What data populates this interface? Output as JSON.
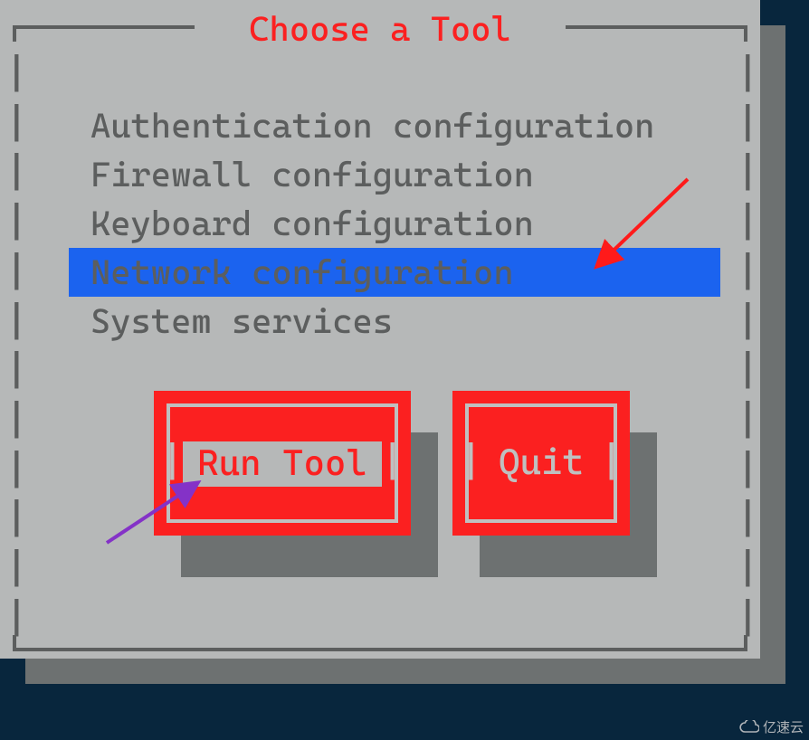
{
  "dialog": {
    "title": "Choose a Tool",
    "items": [
      {
        "label": "Authentication configuration",
        "selected": false
      },
      {
        "label": "Firewall configuration",
        "selected": false
      },
      {
        "label": "Keyboard configuration",
        "selected": false
      },
      {
        "label": "Network configuration",
        "selected": true
      },
      {
        "label": "System services",
        "selected": false
      }
    ],
    "buttons": {
      "run": {
        "label": "Run Tool",
        "focused": true
      },
      "quit": {
        "label": "Quit",
        "focused": false
      }
    }
  },
  "annotations": {
    "arrow_to_selection": {
      "color": "#ff1a1a",
      "target": "Network configuration"
    },
    "arrow_to_run": {
      "color": "#8432c7",
      "target": "Run Tool"
    }
  },
  "watermark": {
    "text": "亿速云"
  },
  "colors": {
    "title": "#fb2020",
    "selection_bg": "#1b63ef",
    "button_bg": "#fb2020",
    "panel_bg": "#b6b8b8"
  }
}
